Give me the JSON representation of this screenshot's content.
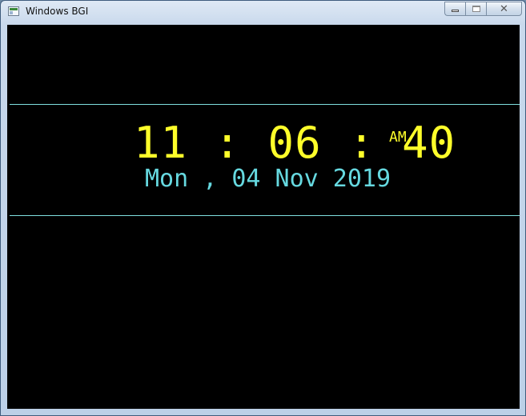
{
  "window": {
    "title": "Windows BGI",
    "icon": "app-window-icon"
  },
  "caption_buttons": {
    "minimize": "minimize-icon",
    "maximize": "maximize-icon",
    "close_glyph": "✕"
  },
  "clock": {
    "time": "11 : 06 : 40",
    "ampm": "AM",
    "date": "Mon , 04 Nov 2019"
  },
  "colors": {
    "background": "#000000",
    "time": "#ffff2a",
    "date": "#66d9e0",
    "divider": "#7fe0e0"
  }
}
